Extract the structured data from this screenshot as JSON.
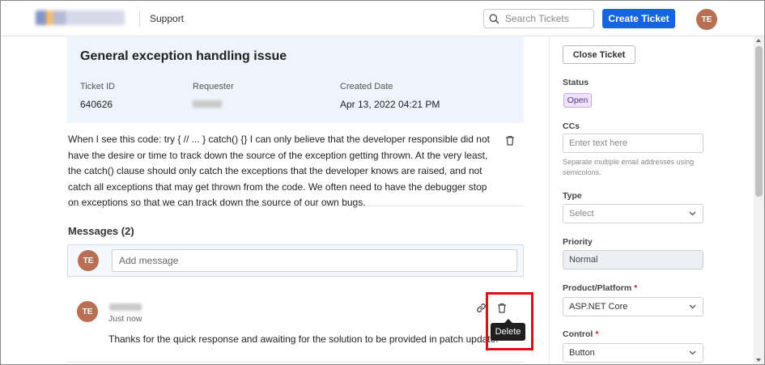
{
  "header": {
    "app_name": "Support",
    "search_placeholder": "Search Tickets",
    "create_label": "Create Ticket",
    "user_initials": "TE"
  },
  "ticket": {
    "title": "General exception handling issue",
    "id_label": "Ticket ID",
    "id_value": "640626",
    "requester_label": "Requester",
    "created_label": "Created Date",
    "created_value": "Apr 13, 2022 04:21 PM",
    "description": "When I see this code: try { // ... } catch() {} I can only believe that the developer responsible did not have the desire or time to track down the source of the exception getting thrown. At the very least, the catch() clause should only catch the exceptions that the developer knows are raised, and not catch all exceptions that may get thrown from the code. We often need to have the debugger stop on exceptions so that we can track down the source of our own bugs."
  },
  "messages": {
    "heading": "Messages (2)",
    "add_placeholder": "Add message",
    "user_initials": "TE",
    "items": [
      {
        "initials": "TE",
        "time": "Just now",
        "text": "Thanks for the quick response and awaiting for the solution to be provided in patch update."
      }
    ],
    "delete_tooltip": "Delete"
  },
  "sidebar": {
    "close_label": "Close Ticket",
    "status_label": "Status",
    "status_value": "Open",
    "ccs_label": "CCs",
    "ccs_placeholder": "Enter text here",
    "ccs_hint": "Separate multiple email addresses using semicolons.",
    "type_label": "Type",
    "type_value": "Select",
    "priority_label": "Priority",
    "priority_value": "Normal",
    "product_label": "Product/Platform",
    "product_value": "ASP.NET Core",
    "control_label": "Control",
    "control_value": "Button",
    "required_mark": "*"
  },
  "colors": {
    "primary": "#1565e0",
    "avatar": "#b86f54",
    "highlight": "#e01010",
    "status_bg": "#efe3fb",
    "info_panel": "#eef4fc"
  },
  "icons": [
    "search-icon",
    "trash-icon",
    "link-icon",
    "chevron-down-icon"
  ]
}
